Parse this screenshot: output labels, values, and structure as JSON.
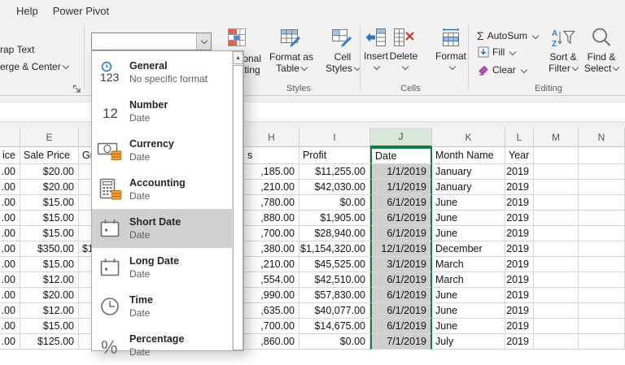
{
  "menubar": {
    "items": [
      "Help",
      "Power Pivot"
    ]
  },
  "ribbon": {
    "alignment_group": {
      "wrap_text": "rap Text",
      "merge_center": "erge & Center"
    },
    "number_group": {
      "format_value": ""
    },
    "styles_group": {
      "label": "Styles",
      "buttons": [
        {
          "line1": "Conditional",
          "line2": "Formatting"
        },
        {
          "line1": "Format as",
          "line2": "Table"
        },
        {
          "line1": "Cell",
          "line2": "Styles"
        }
      ]
    },
    "cells_group": {
      "label": "Cells",
      "buttons": [
        "Insert",
        "Delete",
        "Format"
      ]
    },
    "editing_group": {
      "label": "Editing",
      "autosum": "AutoSum",
      "fill": "Fill",
      "clear": "Clear",
      "sort_filter_line1": "Sort &",
      "sort_filter_line2": "Filter",
      "find_select_line1": "Find &",
      "find_select_line2": "Select"
    }
  },
  "format_dropdown": {
    "items": [
      {
        "name": "General",
        "preview": "No specific format",
        "icon": "general-123-icon",
        "highlighted": false
      },
      {
        "name": "Number",
        "preview": "Date",
        "icon": "number-12-icon",
        "highlighted": false
      },
      {
        "name": "Currency",
        "preview": "Date",
        "icon": "currency-coins-icon",
        "highlighted": false
      },
      {
        "name": "Accounting",
        "preview": "Date",
        "icon": "accounting-calculator-icon",
        "highlighted": false
      },
      {
        "name": "Short Date",
        "preview": "Date",
        "icon": "calendar-icon",
        "highlighted": true
      },
      {
        "name": "Long Date",
        "preview": "Date",
        "icon": "calendar-icon",
        "highlighted": false
      },
      {
        "name": "Time",
        "preview": "Date",
        "icon": "clock-icon",
        "highlighted": false
      },
      {
        "name": "Percentage",
        "preview": "Date",
        "icon": "percent-icon",
        "highlighted": false
      }
    ]
  },
  "spreadsheet": {
    "selected_column": "J",
    "columns": [
      {
        "letter": "",
        "header": "ice",
        "key": "d",
        "selected": false
      },
      {
        "letter": "E",
        "header": "Sale Price",
        "key": "e",
        "selected": false
      },
      {
        "letter": "",
        "header": "Gr",
        "key": "fg",
        "selected": false
      },
      {
        "letter": "H",
        "header": "s",
        "key": "h",
        "selected": false
      },
      {
        "letter": "I",
        "header": "Profit",
        "key": "i",
        "selected": false
      },
      {
        "letter": "J",
        "header": "Date",
        "key": "j",
        "selected": true
      },
      {
        "letter": "K",
        "header": "Month Name",
        "key": "k",
        "selected": false
      },
      {
        "letter": "L",
        "header": "Year",
        "key": "l",
        "selected": false
      },
      {
        "letter": "M",
        "header": "",
        "key": "m",
        "selected": false
      },
      {
        "letter": "N",
        "header": "",
        "key": "n",
        "selected": false
      }
    ],
    "rows": [
      {
        "d": ".00",
        "e": "$20.00",
        "fg": "",
        "h": ",185.00",
        "i": "$11,255.00",
        "j": "1/1/2019",
        "k": "January",
        "l": "2019"
      },
      {
        "d": ".00",
        "e": "$20.00",
        "fg": "",
        "h": ",210.00",
        "i": "$42,030.00",
        "j": "1/1/2019",
        "k": "January",
        "l": "2019"
      },
      {
        "d": ".00",
        "e": "$15.00",
        "fg": "",
        "h": ",780.00",
        "i": "$0.00",
        "j": "6/1/2019",
        "k": "June",
        "l": "2019"
      },
      {
        "d": ".00",
        "e": "$15.00",
        "fg": "",
        "h": ",880.00",
        "i": "$1,905.00",
        "j": "6/1/2019",
        "k": "June",
        "l": "2019"
      },
      {
        "d": ".00",
        "e": "$15.00",
        "fg": "",
        "h": ",700.00",
        "i": "$28,940.00",
        "j": "6/1/2019",
        "k": "June",
        "l": "2019"
      },
      {
        "d": ".00",
        "e": "$350.00",
        "fg": "$1",
        "h": ",380.00",
        "i": "$1,154,320.00",
        "j": "12/1/2019",
        "k": "December",
        "l": "2019"
      },
      {
        "d": ".00",
        "e": "$15.00",
        "fg": "",
        "h": ",210.00",
        "i": "$45,525.00",
        "j": "3/1/2019",
        "k": "March",
        "l": "2019"
      },
      {
        "d": ".00",
        "e": "$12.00",
        "fg": "",
        "h": ",554.00",
        "i": "$42,510.00",
        "j": "6/1/2019",
        "k": "March",
        "l": "2019"
      },
      {
        "d": ".00",
        "e": "$20.00",
        "fg": "",
        "h": ",990.00",
        "i": "$57,830.00",
        "j": "6/1/2019",
        "k": "June",
        "l": "2019"
      },
      {
        "d": ".00",
        "e": "$12.00",
        "fg": "",
        "h": ",635.00",
        "i": "$40,077.00",
        "j": "6/1/2019",
        "k": "June",
        "l": "2019"
      },
      {
        "d": ".00",
        "e": "$15.00",
        "fg": "",
        "h": ",700.00",
        "i": "$14,675.00",
        "j": "6/1/2019",
        "k": "June",
        "l": "2019"
      },
      {
        "d": ".00",
        "e": "$125.00",
        "fg": "",
        "h": ",860.00",
        "i": "$0.00",
        "j": "7/1/2019",
        "k": "July",
        "l": "2019"
      }
    ]
  },
  "colors": {
    "selection_green": "#107C41",
    "selected_column_fill": "#D0CECE",
    "selected_header_fill": "#D7E7D7",
    "menu_highlight_gray": "#D2D0CE",
    "coin_orange": "#E8A33D",
    "accent_blue": "#2B7CD3",
    "delete_red": "#C0392B",
    "clear_purple": "#B44FBF",
    "ribbon_bg": "#F3F2F1"
  }
}
